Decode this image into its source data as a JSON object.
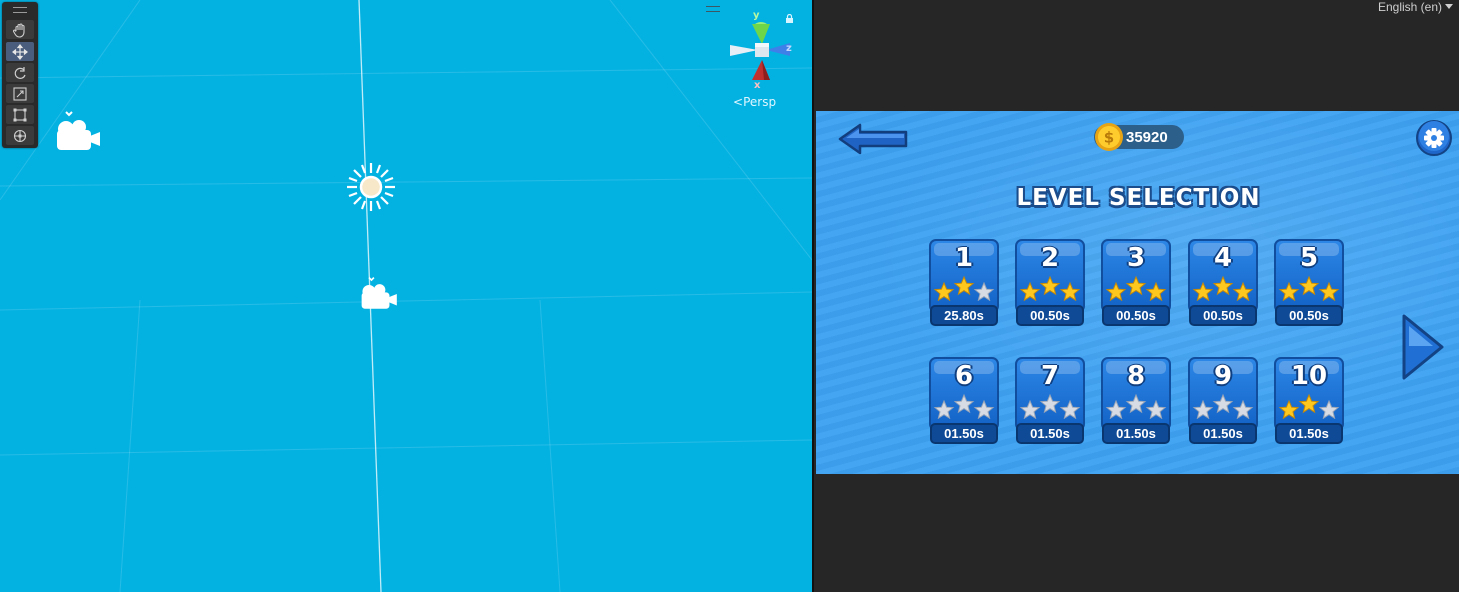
{
  "scene_view": {
    "tools": [
      {
        "name": "hand-tool-icon",
        "active": false
      },
      {
        "name": "move-tool-icon",
        "active": true
      },
      {
        "name": "rotate-tool-icon",
        "active": false
      },
      {
        "name": "scale-tool-icon",
        "active": false
      },
      {
        "name": "rect-tool-icon",
        "active": false
      },
      {
        "name": "transform-tool-icon",
        "active": false
      }
    ],
    "gizmo": {
      "y_label": "y",
      "z_label": "z",
      "x_label": "x",
      "projection": "Persp"
    }
  },
  "game_view": {
    "language": "English (en)",
    "coins": "35920",
    "title": "LEVEL SELECTION",
    "levels": [
      {
        "number": "1",
        "stars": 2,
        "time": "25.80s"
      },
      {
        "number": "2",
        "stars": 3,
        "time": "00.50s"
      },
      {
        "number": "3",
        "stars": 3,
        "time": "00.50s"
      },
      {
        "number": "4",
        "stars": 3,
        "time": "00.50s"
      },
      {
        "number": "5",
        "stars": 3,
        "time": "00.50s"
      },
      {
        "number": "6",
        "stars": 0,
        "time": "01.50s"
      },
      {
        "number": "7",
        "stars": 0,
        "time": "01.50s"
      },
      {
        "number": "8",
        "stars": 0,
        "time": "01.50s"
      },
      {
        "number": "9",
        "stars": 0,
        "time": "01.50s"
      },
      {
        "number": "10",
        "stars": 2,
        "time": "01.50s"
      }
    ],
    "colors": {
      "star_filled": "#ffc81e",
      "star_empty": "#d7dce4",
      "background": "#3ea2f3",
      "tile": "#1e74d8"
    }
  }
}
